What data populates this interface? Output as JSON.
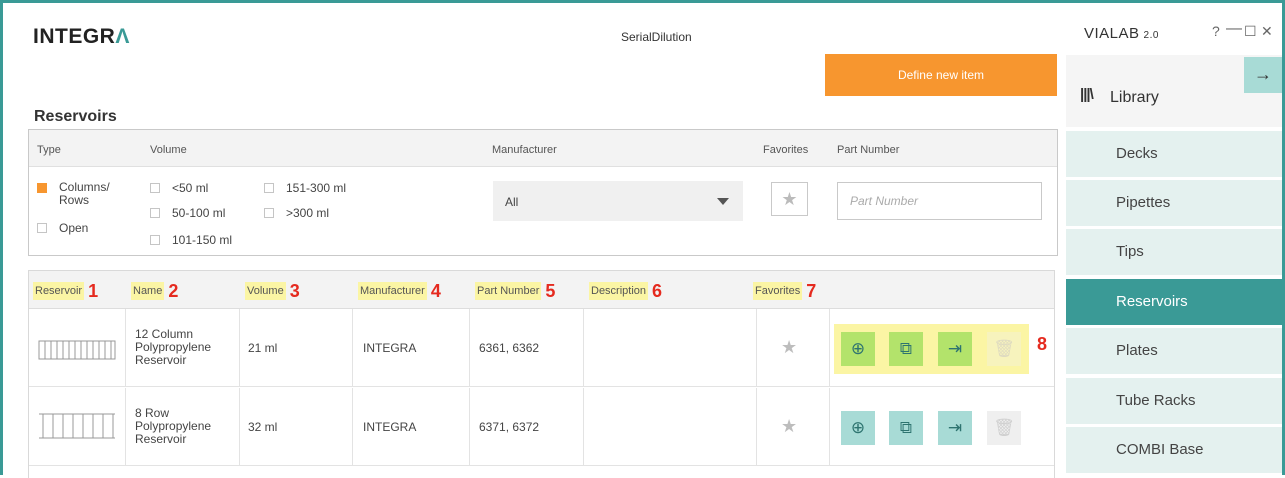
{
  "header": {
    "logo_text": "INTEGR",
    "logo_accent": "Λ",
    "window_title": "SerialDilution",
    "define_button": "Define new item"
  },
  "section_title": "Reservoirs",
  "filters": {
    "headers": {
      "type": "Type",
      "volume": "Volume",
      "manufacturer": "Manufacturer",
      "favorites": "Favorites",
      "part_number": "Part Number"
    },
    "type_options": [
      {
        "label": "Columns/\nRows",
        "checked": true
      },
      {
        "label": "Open",
        "checked": false
      }
    ],
    "volume_options": [
      "<50 ml",
      "50-100 ml",
      "101-150 ml",
      "151-300 ml",
      ">300 ml"
    ],
    "manufacturer_selected": "All",
    "part_number_placeholder": "Part Number"
  },
  "table": {
    "columns": [
      {
        "label": "Reservoir",
        "num": "1"
      },
      {
        "label": "Name",
        "num": "2"
      },
      {
        "label": "Volume",
        "num": "3"
      },
      {
        "label": "Manufacturer",
        "num": "4"
      },
      {
        "label": "Part Number",
        "num": "5"
      },
      {
        "label": "Description",
        "num": "6"
      },
      {
        "label": "Favorites",
        "num": "7"
      }
    ],
    "actions_num": "8",
    "rows": [
      {
        "name": "12 Column\nPolypropylene\nReservoir",
        "volume": "21 ml",
        "manufacturer": "INTEGRA",
        "part_number": "6361, 6362",
        "description": ""
      },
      {
        "name": "8 Row\nPolypropylene\nReservoir",
        "volume": "32 ml",
        "manufacturer": "INTEGRA",
        "part_number": "6371, 6372",
        "description": ""
      }
    ]
  },
  "sidebar": {
    "app_name": "VIALAB",
    "version": "2.0",
    "help": "?",
    "library_label": "Library",
    "items": [
      {
        "label": "Decks",
        "active": false
      },
      {
        "label": "Pipettes",
        "active": false
      },
      {
        "label": "Tips",
        "active": false
      },
      {
        "label": "Reservoirs",
        "active": true
      },
      {
        "label": "Plates",
        "active": false
      },
      {
        "label": "Tube Racks",
        "active": false
      },
      {
        "label": "COMBI Base",
        "active": false
      }
    ]
  },
  "icons": {
    "zoom": "zoom-in-icon",
    "copy": "copy-icon",
    "export": "export-icon",
    "delete": "trash-icon",
    "favorite": "star-icon",
    "library": "library-books-icon",
    "collapse": "arrow-right-icon"
  },
  "colors": {
    "teal": "#3a9a96",
    "orange": "#f7962f",
    "light_teal": "#a8dbd6",
    "highlight": "#fbf5a4",
    "annotation_red": "#e52a1f"
  }
}
